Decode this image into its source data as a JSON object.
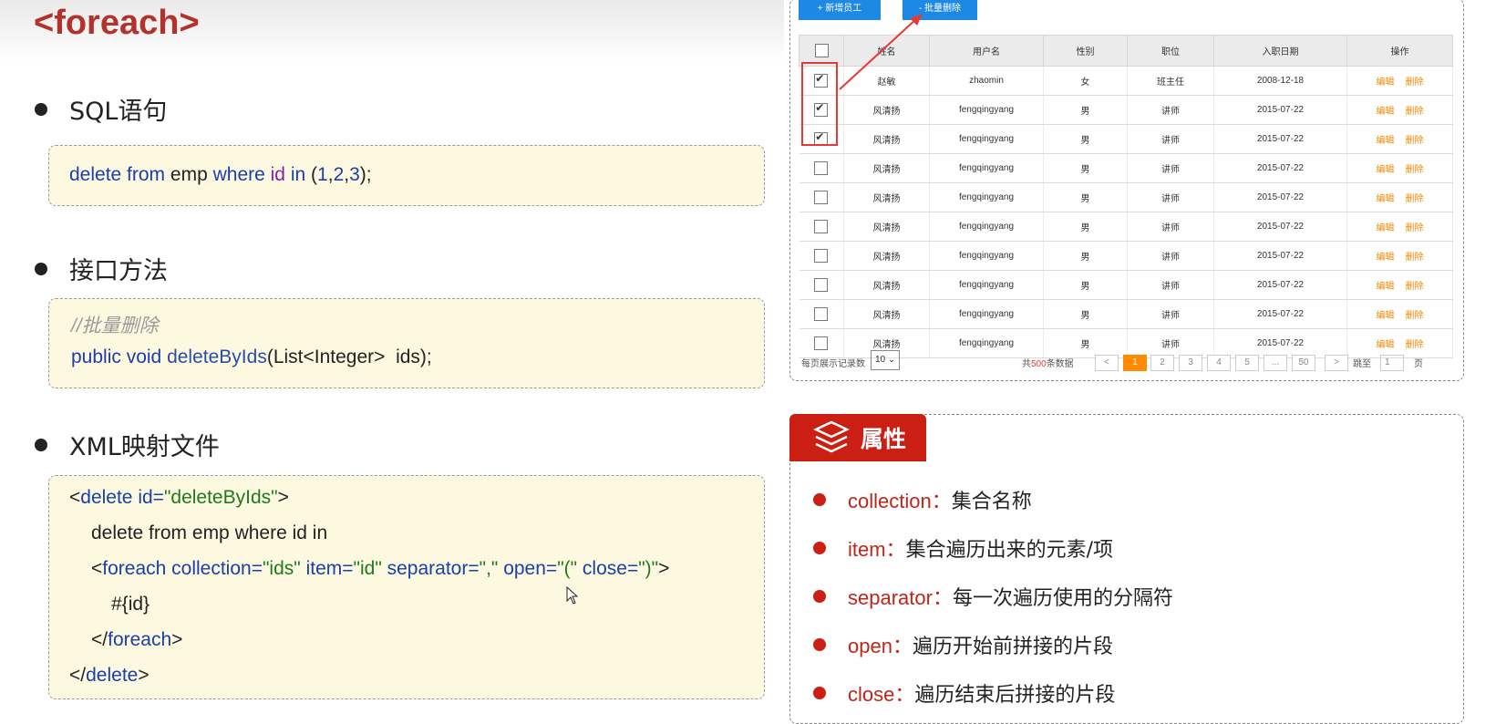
{
  "slide": {
    "title": "<foreach>",
    "sections": [
      {
        "heading": "SQL语句"
      },
      {
        "heading": "接口方法"
      },
      {
        "heading": "XML映射文件"
      }
    ],
    "sql": {
      "p1": "delete from",
      "p2": " emp ",
      "p3": "where",
      "p4": " ",
      "p5": "id",
      "p6": " ",
      "p7": "in",
      "p8": " (",
      "n1": "1",
      "c1": ",",
      "n2": "2",
      "c2": ",",
      "n3": "3",
      "p9": ");"
    },
    "iface": {
      "comment": "//批量删除",
      "p1": "public void",
      "p2": " ",
      "p3": "deleteByIds",
      "p4": "(List<Integer>  ids);"
    },
    "xml": {
      "l1a": "<",
      "l1b": "delete",
      "l1c": " id=",
      "l1d": "\"deleteByIds\"",
      "l1e": ">",
      "l2": "delete from emp where id in",
      "l3a": "<",
      "l3b": "foreach collection=",
      "l3c": "\"ids\"",
      "l3d": " item=",
      "l3e": "\"id\"",
      "l3f": " separator=",
      "l3g": "\",\"",
      "l3h": " open=",
      "l3i": "\"(\"",
      "l3j": " close=",
      "l3k": "\")\"",
      "l3l": ">",
      "l4": "#{id}",
      "l5a": "</",
      "l5b": "foreach",
      "l5c": ">",
      "l6a": "</",
      "l6b": "delete",
      "l6c": ">"
    }
  },
  "table_ui": {
    "add_button": "+ 新增员工",
    "batch_delete_button": "- 批量删除",
    "columns": [
      "",
      "姓名",
      "用户名",
      "性别",
      "职位",
      "入职日期",
      "操作"
    ],
    "rows": [
      {
        "checked": true,
        "name": "赵敏",
        "username": "zhaomin",
        "gender": "女",
        "position": "班主任",
        "date": "2008-12-18"
      },
      {
        "checked": true,
        "name": "风清扬",
        "username": "fengqingyang",
        "gender": "男",
        "position": "讲师",
        "date": "2015-07-22"
      },
      {
        "checked": true,
        "name": "风清扬",
        "username": "fengqingyang",
        "gender": "男",
        "position": "讲师",
        "date": "2015-07-22"
      },
      {
        "checked": false,
        "name": "风清扬",
        "username": "fengqingyang",
        "gender": "男",
        "position": "讲师",
        "date": "2015-07-22"
      },
      {
        "checked": false,
        "name": "风清扬",
        "username": "fengqingyang",
        "gender": "男",
        "position": "讲师",
        "date": "2015-07-22"
      },
      {
        "checked": false,
        "name": "风清扬",
        "username": "fengqingyang",
        "gender": "男",
        "position": "讲师",
        "date": "2015-07-22"
      },
      {
        "checked": false,
        "name": "风清扬",
        "username": "fengqingyang",
        "gender": "男",
        "position": "讲师",
        "date": "2015-07-22"
      },
      {
        "checked": false,
        "name": "风清扬",
        "username": "fengqingyang",
        "gender": "男",
        "position": "讲师",
        "date": "2015-07-22"
      },
      {
        "checked": false,
        "name": "风清扬",
        "username": "fengqingyang",
        "gender": "男",
        "position": "讲师",
        "date": "2015-07-22"
      },
      {
        "checked": false,
        "name": "风清扬",
        "username": "fengqingyang",
        "gender": "男",
        "position": "讲师",
        "date": "2015-07-22"
      }
    ],
    "edit_label": "编辑",
    "delete_label": "删除",
    "page_size_label": "每页展示记录数",
    "page_size_value": "10",
    "total_pre": "共",
    "total_num": "500",
    "total_post": "条数据",
    "pages": [
      "<",
      "1",
      "2",
      "3",
      "4",
      "5",
      "...",
      "50",
      ">"
    ],
    "jump_label": "跳至",
    "jump_value": "1",
    "page_suffix": "页"
  },
  "attributes": {
    "tab_label": "属性",
    "items": [
      {
        "key": "collection：",
        "desc": "集合名称"
      },
      {
        "key": "item：",
        "desc": "集合遍历出来的元素/项"
      },
      {
        "key": "separator：",
        "desc": "每一次遍历使用的分隔符"
      },
      {
        "key": "open：",
        "desc": "遍历开始前拼接的片段"
      },
      {
        "key": "close：",
        "desc": "遍历结束后拼接的片段"
      }
    ]
  },
  "colors": {
    "title": "#b3322b",
    "accent_red": "#cc1f14",
    "code_bg": "#fdf9e1",
    "button_blue": "#1e88e5",
    "orange": "#ff8c00"
  }
}
